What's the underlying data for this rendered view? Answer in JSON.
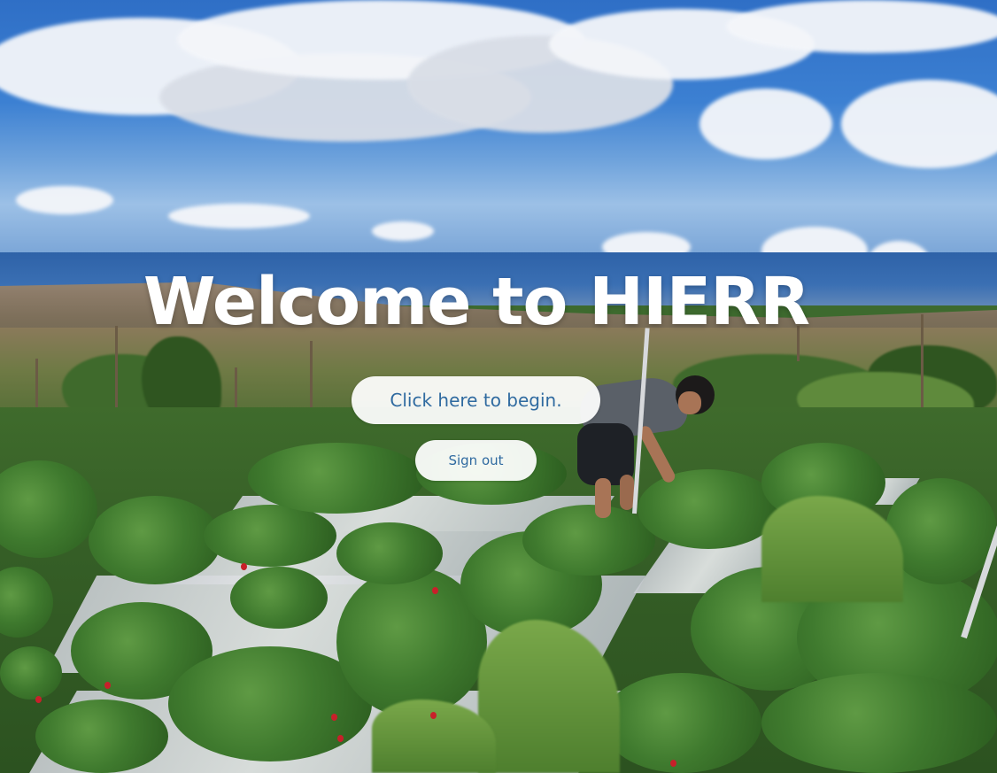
{
  "hero": {
    "title": "Welcome to HIERR",
    "begin_button_label": "Click here to begin.",
    "signout_button_label": "Sign out"
  },
  "background": {
    "description_icon": "strawberry-farm-photo"
  },
  "colors": {
    "button_text": "#2f6aa0",
    "button_background": "#ffffff",
    "title_text": "#ffffff"
  }
}
